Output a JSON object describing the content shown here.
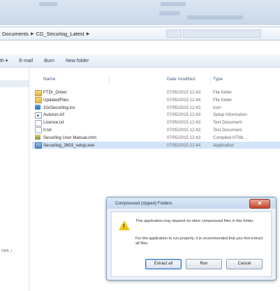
{
  "top_chrome": {},
  "address_bar": {
    "crumbs": [
      "Documents",
      "CD_Securlog_Latest"
    ]
  },
  "toolbar": {
    "items": [
      "th ▾",
      "E-mail",
      "Burn",
      "New folder"
    ]
  },
  "nav": {
    "partial_label": "ORK_I"
  },
  "columns": {
    "name": "Name",
    "date": "Date modified",
    "type": "Type"
  },
  "files": [
    {
      "name": "FTDI_Driver",
      "date": "07/05/2015 12:43",
      "type": "File folder",
      "icon": "folder-icon"
    },
    {
      "name": "UpdatedFiles",
      "date": "07/05/2015 12:44",
      "type": "File folder",
      "icon": "folder-icon"
    },
    {
      "name": "32xSecurilog.ico",
      "date": "07/05/2015 12:43",
      "type": "Icon",
      "icon": "ico-file-icon"
    },
    {
      "name": "Autorun.inf",
      "date": "07/05/2015 12:43",
      "type": "Setup Information",
      "icon": "setup-file-icon"
    },
    {
      "name": "Licence.txt",
      "date": "07/05/2015 12:43",
      "type": "Text Document",
      "icon": "text-file-icon"
    },
    {
      "name": "rl.txt",
      "date": "07/05/2015 12:43",
      "type": "Text Document",
      "icon": "text-file-icon"
    },
    {
      "name": "Securilog User Manual.chm",
      "date": "07/05/2015 12:43",
      "type": "Compiled HTML ...",
      "icon": "chm-file-icon"
    },
    {
      "name": "Securilog_2603_setup.exe",
      "date": "07/05/2015 12:44",
      "type": "Application",
      "icon": "exe-file-icon",
      "selected": true
    }
  ],
  "dialog": {
    "title": "Compressed (zipped) Folders",
    "close_label": "✕",
    "message": "This application may depend on other compressed files in this folder.",
    "message2": "For the application to run properly, it is recommended that you first extract all files.",
    "buttons": [
      "Extract all",
      "Run",
      "Cancel"
    ]
  }
}
